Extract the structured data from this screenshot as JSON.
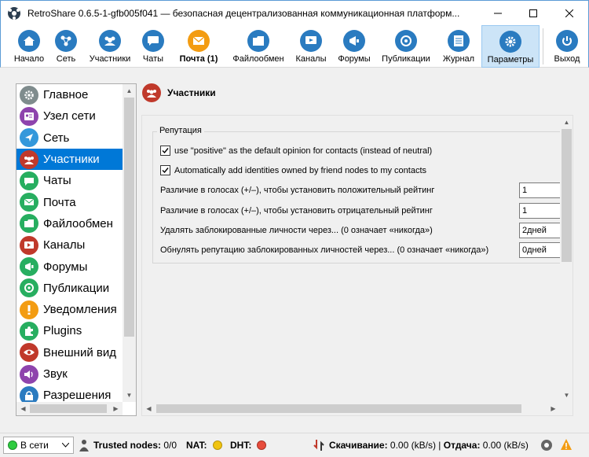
{
  "window": {
    "title": "RetroShare 0.6.5-1-gfb005f041 — безопасная децентрализованная коммуникационная платформ...",
    "minimize_icon": "minimize-icon",
    "maximize_icon": "maximize-icon",
    "close_icon": "close-icon"
  },
  "toolbar": {
    "items": [
      {
        "label": "Начало",
        "icon": "home-icon",
        "color": "#2a7bc0"
      },
      {
        "label": "Сеть",
        "icon": "network-icon",
        "color": "#2a7bc0"
      },
      {
        "label": "Участники",
        "icon": "people-icon",
        "color": "#2a7bc0"
      },
      {
        "label": "Чаты",
        "icon": "chat-icon",
        "color": "#2a7bc0"
      },
      {
        "label": "Почта (1)",
        "icon": "mail-icon",
        "color": "#f39c12"
      },
      {
        "label": "Файлообмен",
        "icon": "files-icon",
        "color": "#2a7bc0"
      },
      {
        "label": "Каналы",
        "icon": "channels-icon",
        "color": "#2a7bc0"
      },
      {
        "label": "Форумы",
        "icon": "forums-icon",
        "color": "#2a7bc0"
      },
      {
        "label": "Публикации",
        "icon": "posted-icon",
        "color": "#2a7bc0"
      },
      {
        "label": "Журнал",
        "icon": "log-icon",
        "color": "#2a7bc0"
      },
      {
        "label": "Параметры",
        "icon": "settings-icon",
        "color": "#2a7bc0"
      },
      {
        "label": "Выход",
        "icon": "power-icon",
        "color": "#2a7bc0"
      }
    ]
  },
  "nav": {
    "items": [
      {
        "label": "Главное",
        "icon": "gear-icon",
        "color": "#7f8c8d"
      },
      {
        "label": "Узел сети",
        "icon": "node-icon",
        "color": "#8e44ad"
      },
      {
        "label": "Сеть",
        "icon": "network-icon",
        "color": "#3498db"
      },
      {
        "label": "Участники",
        "icon": "people-icon",
        "color": "#c0392b"
      },
      {
        "label": "Чаты",
        "icon": "chat-icon",
        "color": "#27ae60"
      },
      {
        "label": "Почта",
        "icon": "mail-icon",
        "color": "#27ae60"
      },
      {
        "label": "Файлообмен",
        "icon": "files-icon",
        "color": "#27ae60"
      },
      {
        "label": "Каналы",
        "icon": "channels-icon",
        "color": "#c0392b"
      },
      {
        "label": "Форумы",
        "icon": "forums-icon",
        "color": "#27ae60"
      },
      {
        "label": "Публикации",
        "icon": "posted-icon",
        "color": "#27ae60"
      },
      {
        "label": "Уведомления",
        "icon": "alert-icon",
        "color": "#f39c12"
      },
      {
        "label": "Plugins",
        "icon": "puzzle-icon",
        "color": "#27ae60"
      },
      {
        "label": "Внешний вид",
        "icon": "eye-icon",
        "color": "#c0392b"
      },
      {
        "label": "Звук",
        "icon": "sound-icon",
        "color": "#8e44ad"
      },
      {
        "label": "Разрешения",
        "icon": "permissions-icon",
        "color": "#2a7bc0"
      }
    ],
    "selected": "Участники"
  },
  "panel": {
    "title": "Участники",
    "group_title": "Репутация",
    "checkbox1": "use \"positive\" as the default opinion for contacts (instead of neutral)",
    "checkbox2": "Automatically add identities owned by friend nodes to my contacts",
    "rows": [
      {
        "label": "Различие в голосах (+/–), чтобы установить положительный рейтинг",
        "value": "1"
      },
      {
        "label": "Различие в голосах (+/–), чтобы установить отрицательный рейтинг",
        "value": "1"
      },
      {
        "label": "Удалять заблокированные личности через... (0 означает «никогда»)",
        "value": "2дней"
      },
      {
        "label": "Обнулять репутацию заблокированных личностей через... (0 означает «никогда»)",
        "value": "0дней"
      }
    ]
  },
  "statusbar": {
    "status": "В сети",
    "trusted_label": "Trusted nodes:",
    "trusted_value": "0/0",
    "nat_label": "NAT:",
    "dht_label": "DHT:",
    "download_label": "Скачивание:",
    "download_value": "0.00 (kB/s)",
    "sep": "|",
    "upload_label": "Отдача:",
    "upload_value": "0.00 (kB/s)",
    "nat_color": "#f1c40f",
    "dht_color": "#e74c3c",
    "status_color": "#2ecc40"
  }
}
